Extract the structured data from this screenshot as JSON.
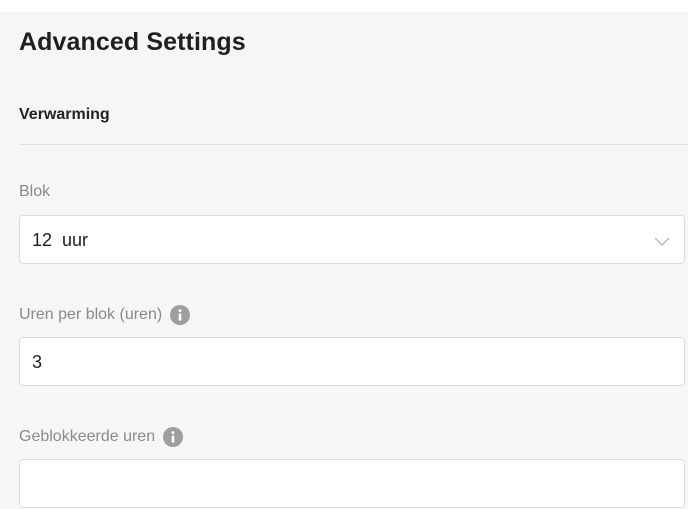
{
  "title": "Advanced Settings",
  "section": "Verwarming",
  "fields": {
    "blok": {
      "label": "Blok",
      "value": "12  uur",
      "control": "select",
      "icon": "chevron-down-icon"
    },
    "uren_per_blok": {
      "label": "Uren per blok (uren)",
      "value": "3",
      "info_icon": "info-icon"
    },
    "geblokkeerde_uren": {
      "label": "Geblokkeerde uren",
      "value": "",
      "info_icon": "info-icon"
    }
  },
  "colors": {
    "background": "#f6f6f6",
    "field_background": "#ffffff",
    "label": "#8a8a8a",
    "info_icon": "#9e9e9e"
  }
}
